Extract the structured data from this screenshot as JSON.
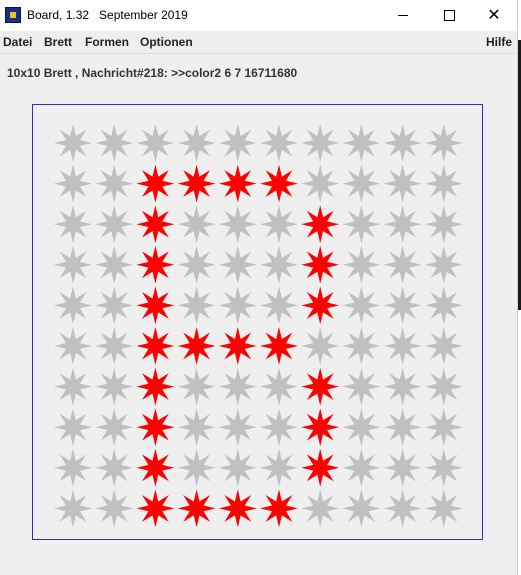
{
  "window": {
    "title": "Board, 1.32   September 2019",
    "icons": {
      "app": "board-app-icon",
      "minimize": "minimize-icon",
      "maximize": "maximize-icon",
      "close": "close-icon"
    },
    "close_glyph": "✕"
  },
  "menu": {
    "items": [
      "Datei",
      "Brett",
      "Formen",
      "Optionen"
    ],
    "help": "Hilfe"
  },
  "status": {
    "message": "10x10 Brett , Nachricht#218: >>color2 6 7 16711680"
  },
  "board": {
    "rows": 10,
    "cols": 10,
    "shape": "8-point star",
    "default_color": "#c0c0c0",
    "highlight_color": "#ff0000",
    "frame_color": "#2f2fbf",
    "highlighted": [
      [
        1,
        2
      ],
      [
        1,
        3
      ],
      [
        1,
        4
      ],
      [
        1,
        5
      ],
      [
        2,
        2
      ],
      [
        2,
        6
      ],
      [
        3,
        2
      ],
      [
        3,
        6
      ],
      [
        4,
        2
      ],
      [
        4,
        6
      ],
      [
        5,
        2
      ],
      [
        5,
        3
      ],
      [
        5,
        4
      ],
      [
        5,
        5
      ],
      [
        6,
        2
      ],
      [
        6,
        6
      ],
      [
        7,
        2
      ],
      [
        7,
        6
      ],
      [
        8,
        2
      ],
      [
        8,
        6
      ],
      [
        9,
        2
      ],
      [
        9,
        3
      ],
      [
        9,
        4
      ],
      [
        9,
        5
      ]
    ]
  }
}
